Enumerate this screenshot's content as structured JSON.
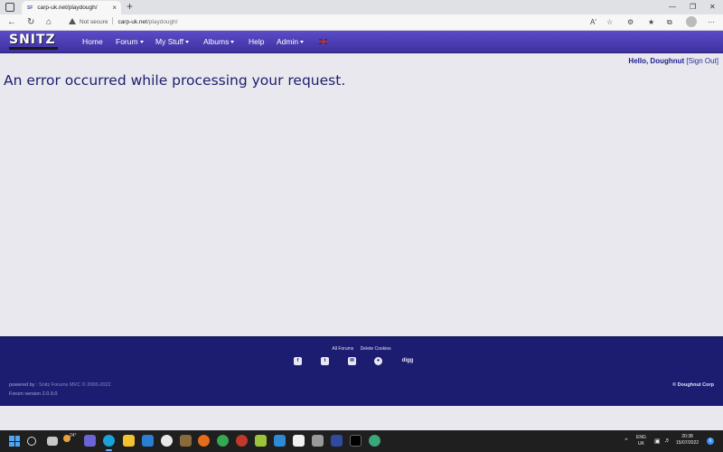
{
  "browser": {
    "tab_title": "carp-uk.net/playdough/",
    "tab_favicon_text": "SF",
    "new_tab_symbol": "+",
    "close_tab_symbol": "×",
    "security_label": "Not secure",
    "url_host": "carp-uk.net",
    "url_path": "/playdough/",
    "icons": [
      "back-icon",
      "refresh-icon",
      "home-icon",
      "read-aloud-icon",
      "favorites-add-icon",
      "extensions-icon",
      "favorites-icon",
      "collections-icon",
      "profile-icon",
      "more-icon"
    ],
    "window_controls": [
      "minimize",
      "restore",
      "close"
    ]
  },
  "site": {
    "logo_text": "SNITZ",
    "nav": {
      "home": "Home",
      "forum": "Forum",
      "my_stuff": "My Stuff",
      "albums": "Albums",
      "help": "Help",
      "admin": "Admin"
    },
    "greeting": {
      "hello": "Hello, Doughnut",
      "sign_out": "[Sign Out]"
    },
    "error_message": "An error occurred while processing your request.",
    "footer": {
      "links": [
        "All Forums",
        "Delete Cookies"
      ],
      "social_icons": [
        "facebook-icon",
        "twitter-icon",
        "email-icon",
        "reddit-icon",
        "digg-icon"
      ],
      "digg_text": "digg",
      "powered_prefix": "powered by :",
      "powered_brand": "Snitz Forums MVC © 2000-2022",
      "version": "Forum version 2.0.0.0",
      "copyright": "© Doughnut Corp"
    }
  },
  "taskbar": {
    "weather_temp": "24°",
    "language": "ENG",
    "region": "UK",
    "time": "20:38",
    "date": "15/07/2022",
    "notification_count": "6"
  },
  "colors": {
    "navbar": "#4a3cb5",
    "footer": "#1c1c70",
    "page_bg": "#e8e8ee",
    "error_text": "#1d1d6e"
  }
}
